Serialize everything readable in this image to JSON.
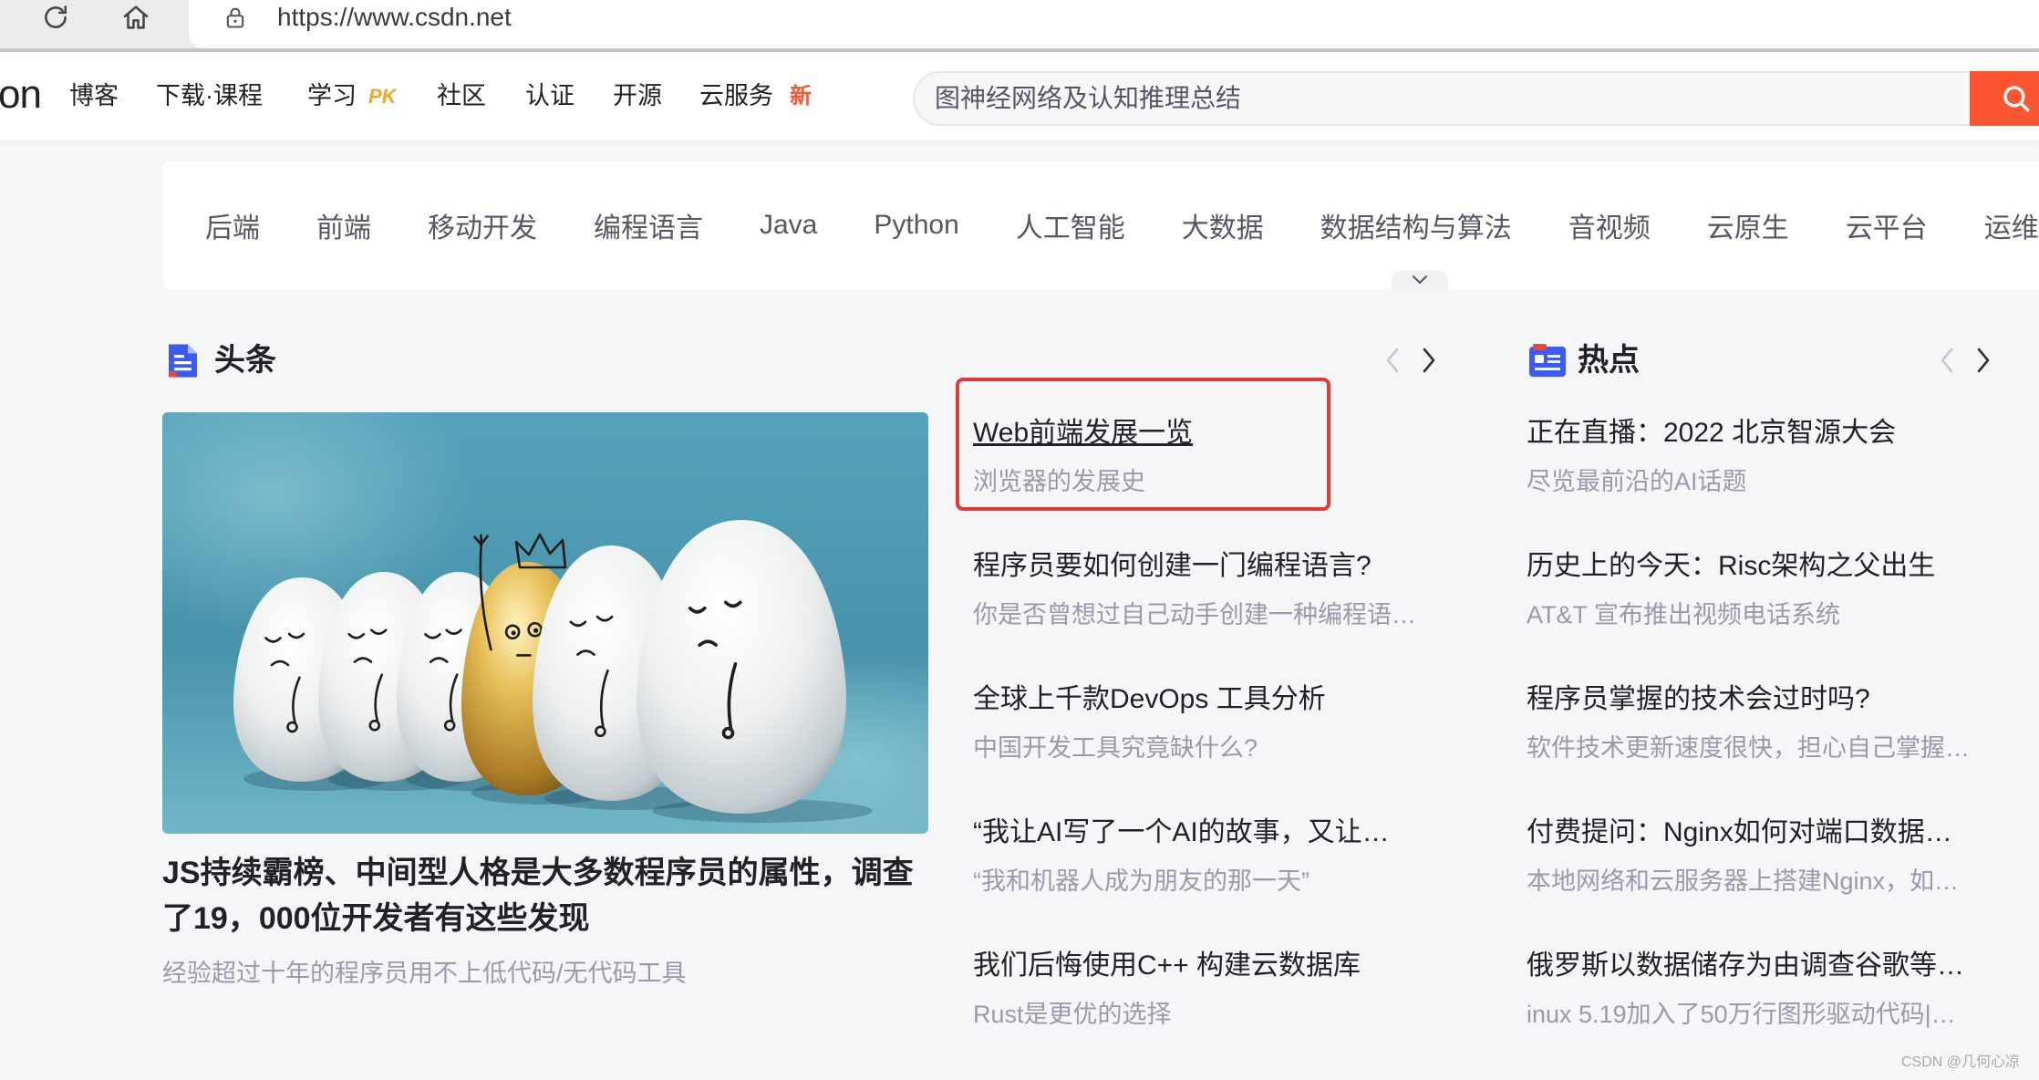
{
  "browser": {
    "url": "https://www.csdn.net"
  },
  "nav": {
    "logo_fragment": "on",
    "items": [
      {
        "label": "博客"
      },
      {
        "label": "下载·课程"
      },
      {
        "label": "学习",
        "badge": "PK"
      },
      {
        "label": "社区"
      },
      {
        "label": "认证"
      },
      {
        "label": "开源"
      },
      {
        "label": "云服务",
        "badge": "新"
      }
    ],
    "search": {
      "placeholder": "图神经网络及认知推理总结"
    }
  },
  "categories": [
    "后端",
    "前端",
    "移动开发",
    "编程语言",
    "Java",
    "Python",
    "人工智能",
    "大数据",
    "数据结构与算法",
    "音视频",
    "云原生",
    "云平台",
    "运维"
  ],
  "headlines": {
    "section_title": "头条",
    "featured": {
      "title": "JS持续霸榜、中间型人格是大多数程序员的属性，调查了19，000位开发者有这些发现",
      "subtitle": "经验超过十年的程序员用不上低代码/无代码工具"
    },
    "items": [
      {
        "title": "Web前端发展一览",
        "subtitle": "浏览器的发展史"
      },
      {
        "title": "程序员要如何创建一门编程语言?",
        "subtitle": "你是否曾想过自己动手创建一种编程语…"
      },
      {
        "title": "全球上千款DevOps 工具分析",
        "subtitle": "中国开发工具究竟缺什么?"
      },
      {
        "title": "“我让AI写了一个AI的故事，又让…",
        "subtitle": "“我和机器人成为朋友的那一天”"
      },
      {
        "title": "我们后悔使用C++ 构建云数据库",
        "subtitle": "Rust是更优的选择"
      }
    ]
  },
  "hot": {
    "section_title": "热点",
    "items": [
      {
        "title": "正在直播：2022 北京智源大会",
        "subtitle": "尽览最前沿的AI话题"
      },
      {
        "title": "历史上的今天：Risc架构之父出生",
        "subtitle": "AT&T 宣布推出视频电话系统"
      },
      {
        "title": "程序员掌握的技术会过时吗?",
        "subtitle": "软件技术更新速度很快，担心自己掌握…"
      },
      {
        "title": "付费提问：Nginx如何对端口数据…",
        "subtitle": "本地网络和云服务器上搭建Nginx，如…"
      },
      {
        "title": "俄罗斯以数据储存为由调查谷歌等…",
        "subtitle": "inux 5.19加入了50万行图形驱动代码|…"
      }
    ]
  },
  "watermark": "CSDN @几何心凉",
  "colors": {
    "accent": "#fc5531",
    "highlight_box": "#e53935",
    "text_primary": "#222226",
    "text_secondary": "#999aaa",
    "icon_blue": "#3c5bf5",
    "badge_pk": "#f5a623"
  },
  "icons": {
    "reload": "refresh-icon",
    "home": "home-icon",
    "secure": "lock-icon",
    "search": "search-icon",
    "more_categories": "chevron-down-icon",
    "headlines": "document-icon",
    "hot": "hot-list-icon",
    "prev": "chevron-left-icon",
    "next": "chevron-right-icon"
  }
}
